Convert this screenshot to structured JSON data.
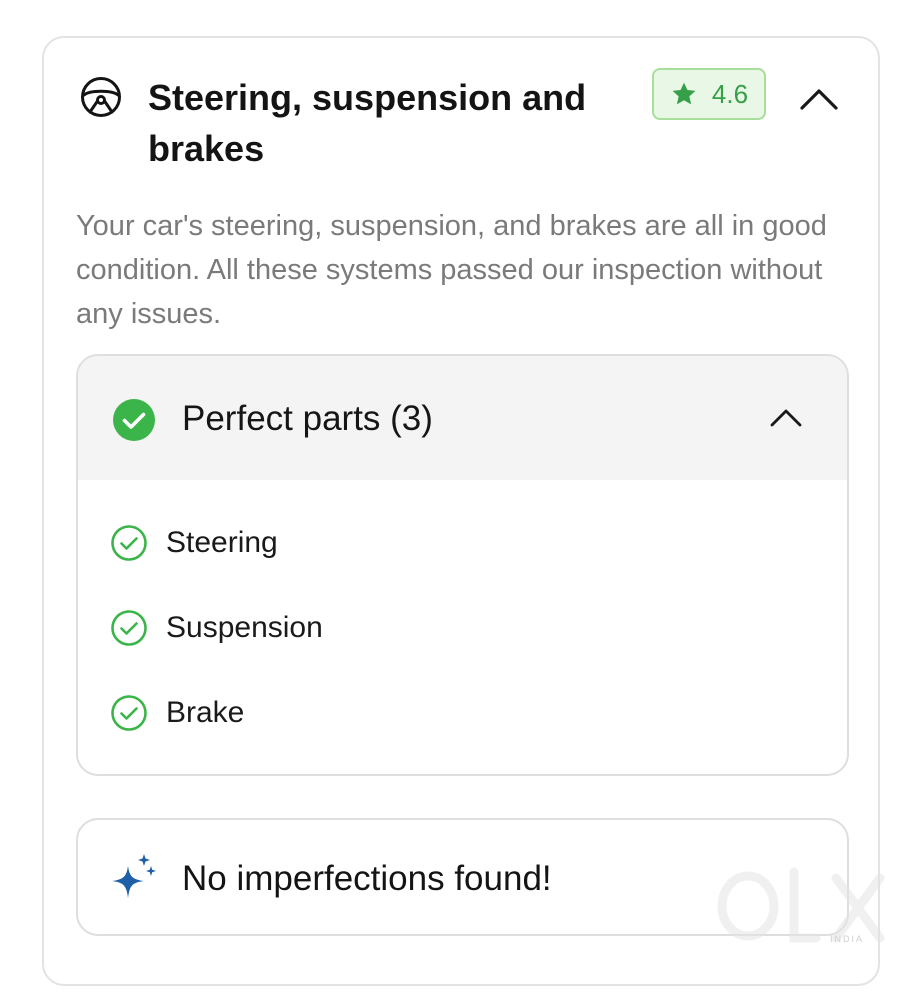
{
  "section": {
    "icon": "steering-wheel-icon",
    "title": "Steering, suspension and brakes",
    "rating": {
      "icon": "star-icon",
      "value": "4.6",
      "color": "#35a047"
    },
    "collapse_icon": "chevron-up-icon",
    "description": "Your car's steering, suspension, and brakes are all in good condition. All these systems passed our inspection without any issues."
  },
  "perfect_parts": {
    "icon": "check-circle-filled-icon",
    "title": "Perfect parts (3)",
    "toggle_icon": "chevron-up-icon",
    "items": [
      {
        "label": "Steering",
        "icon": "check-circle-outline-icon"
      },
      {
        "label": "Suspension",
        "icon": "check-circle-outline-icon"
      },
      {
        "label": "Brake",
        "icon": "check-circle-outline-icon"
      }
    ]
  },
  "imperfections": {
    "icon": "sparkle-icon",
    "text": "No imperfections found!"
  },
  "watermark": {
    "logo": "olx-logo",
    "sub": "INDIA"
  },
  "colors": {
    "success_green": "#3bb54a",
    "badge_bg": "#e9f8e6",
    "sparkle_blue": "#1f5fa8",
    "muted_text": "#7a7a7a"
  }
}
